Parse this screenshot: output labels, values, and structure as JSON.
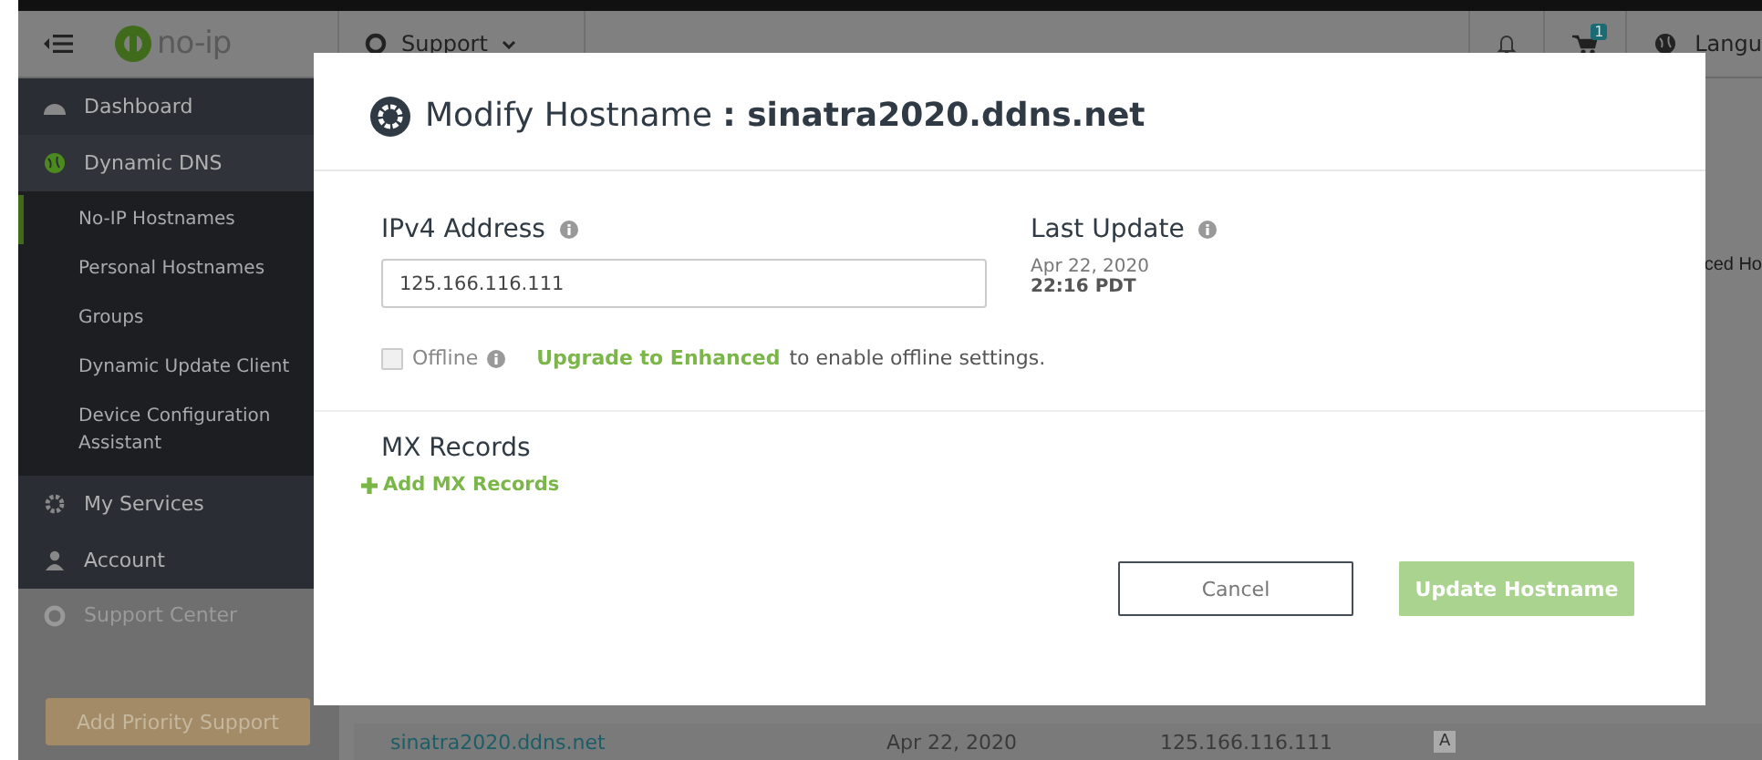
{
  "topbar": {
    "logo": "no-ip",
    "support_menu": "Support",
    "cart_count": "1",
    "language": "Langu"
  },
  "sidebar": {
    "items": [
      {
        "label": "Dashboard"
      },
      {
        "label": "Dynamic DNS",
        "expanded": true,
        "children": [
          {
            "label": "No-IP Hostnames",
            "selected": true
          },
          {
            "label": "Personal Hostnames",
            "selected": false
          },
          {
            "label": "Groups",
            "selected": false
          },
          {
            "label": "Dynamic Update Client",
            "selected": false
          },
          {
            "label": "Device Configuration Assistant",
            "selected": false
          }
        ]
      },
      {
        "label": "My Services"
      },
      {
        "label": "Account"
      }
    ],
    "support_center": "Support Center",
    "priority_button": "Add Priority Support"
  },
  "background": {
    "heading_fragment": "ced Ho",
    "row": {
      "hostname": "sinatra2020.ddns.net",
      "last_update": "Apr 22, 2020",
      "ip": "125.166.116.111",
      "type": "A"
    }
  },
  "dialog": {
    "title": "Modify Hostname **: sinatra2020.ddns.net**",
    "ipv4_label": "IPv4 Address",
    "ipv4_value": "125.166.116.111",
    "last_update_label": "Last Update",
    "last_update_date": "Apr 22, 2020",
    "last_update_time": "22:16 PDT",
    "offline": {
      "label": "Offline",
      "checked": false,
      "disabled": true
    },
    "upgrade_link": "Upgrade to Enhanced",
    "upgrade_text": "to enable offline settings.",
    "mx_heading": "MX Records",
    "add_mx": "Add MX Records",
    "buttons": [
      {
        "label": "Cancel",
        "kind": "secondary",
        "disabled": false
      },
      {
        "label": "Update Hostname",
        "kind": "primary",
        "disabled": true
      }
    ]
  }
}
